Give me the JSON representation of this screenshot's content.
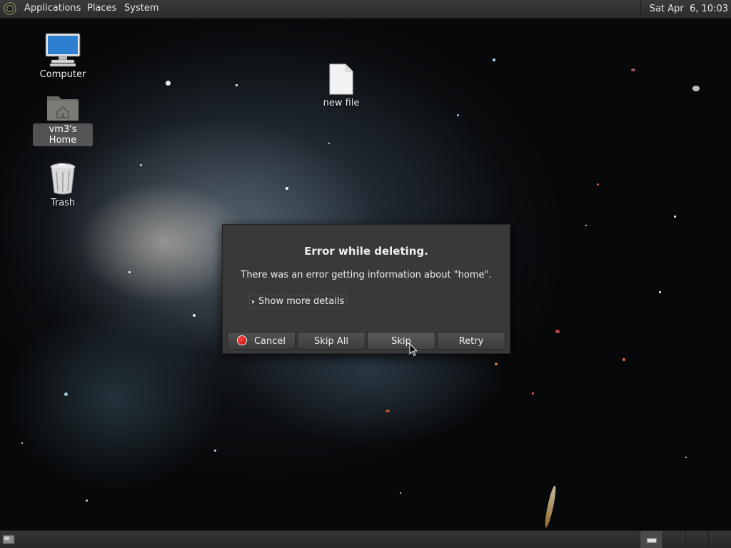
{
  "top_panel": {
    "menus": [
      "Applications",
      "Places",
      "System"
    ],
    "clock": "Sat Apr  6, 10:03",
    "logo_icon": "distro-logo-icon"
  },
  "desktop": {
    "icons": [
      {
        "label": "Computer",
        "icon": "computer-monitor-icon",
        "selected": false
      },
      {
        "label": "vm3's Home",
        "icon": "home-folder-icon",
        "selected": true
      },
      {
        "label": "Trash",
        "icon": "trash-can-icon",
        "selected": false
      },
      {
        "label": "new file",
        "icon": "document-file-icon",
        "selected": false
      }
    ]
  },
  "dialog": {
    "title": "Error while deleting.",
    "message": "There was an error getting information about \"home\".",
    "details_label": "Show more details",
    "buttons": {
      "cancel": "Cancel",
      "skip_all": "Skip All",
      "skip": "Skip",
      "retry": "Retry"
    }
  },
  "bottom_panel": {
    "show_desktop_icon": "show-desktop-icon",
    "workspaces": 4,
    "current_workspace": 1
  },
  "colors": {
    "panel": "#2f2f2f",
    "dialog_bg": "#393939",
    "cancel_icon": "#e02020"
  }
}
